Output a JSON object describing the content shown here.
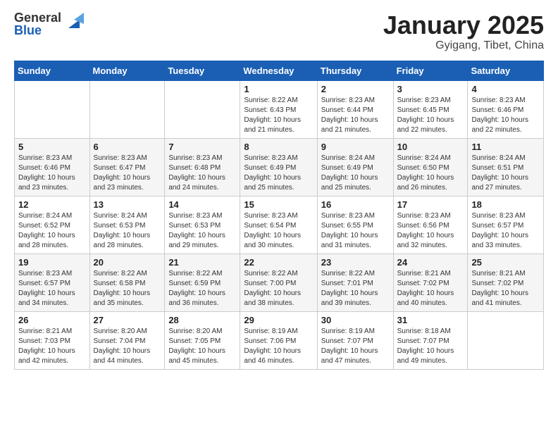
{
  "header": {
    "logo_general": "General",
    "logo_blue": "Blue",
    "month_title": "January 2025",
    "location": "Gyigang, Tibet, China"
  },
  "days_of_week": [
    "Sunday",
    "Monday",
    "Tuesday",
    "Wednesday",
    "Thursday",
    "Friday",
    "Saturday"
  ],
  "weeks": [
    [
      {
        "day": "",
        "info": ""
      },
      {
        "day": "",
        "info": ""
      },
      {
        "day": "",
        "info": ""
      },
      {
        "day": "1",
        "info": "Sunrise: 8:22 AM\nSunset: 6:43 PM\nDaylight: 10 hours and 21 minutes."
      },
      {
        "day": "2",
        "info": "Sunrise: 8:23 AM\nSunset: 6:44 PM\nDaylight: 10 hours and 21 minutes."
      },
      {
        "day": "3",
        "info": "Sunrise: 8:23 AM\nSunset: 6:45 PM\nDaylight: 10 hours and 22 minutes."
      },
      {
        "day": "4",
        "info": "Sunrise: 8:23 AM\nSunset: 6:46 PM\nDaylight: 10 hours and 22 minutes."
      }
    ],
    [
      {
        "day": "5",
        "info": "Sunrise: 8:23 AM\nSunset: 6:46 PM\nDaylight: 10 hours and 23 minutes."
      },
      {
        "day": "6",
        "info": "Sunrise: 8:23 AM\nSunset: 6:47 PM\nDaylight: 10 hours and 23 minutes."
      },
      {
        "day": "7",
        "info": "Sunrise: 8:23 AM\nSunset: 6:48 PM\nDaylight: 10 hours and 24 minutes."
      },
      {
        "day": "8",
        "info": "Sunrise: 8:23 AM\nSunset: 6:49 PM\nDaylight: 10 hours and 25 minutes."
      },
      {
        "day": "9",
        "info": "Sunrise: 8:24 AM\nSunset: 6:49 PM\nDaylight: 10 hours and 25 minutes."
      },
      {
        "day": "10",
        "info": "Sunrise: 8:24 AM\nSunset: 6:50 PM\nDaylight: 10 hours and 26 minutes."
      },
      {
        "day": "11",
        "info": "Sunrise: 8:24 AM\nSunset: 6:51 PM\nDaylight: 10 hours and 27 minutes."
      }
    ],
    [
      {
        "day": "12",
        "info": "Sunrise: 8:24 AM\nSunset: 6:52 PM\nDaylight: 10 hours and 28 minutes."
      },
      {
        "day": "13",
        "info": "Sunrise: 8:24 AM\nSunset: 6:53 PM\nDaylight: 10 hours and 28 minutes."
      },
      {
        "day": "14",
        "info": "Sunrise: 8:23 AM\nSunset: 6:53 PM\nDaylight: 10 hours and 29 minutes."
      },
      {
        "day": "15",
        "info": "Sunrise: 8:23 AM\nSunset: 6:54 PM\nDaylight: 10 hours and 30 minutes."
      },
      {
        "day": "16",
        "info": "Sunrise: 8:23 AM\nSunset: 6:55 PM\nDaylight: 10 hours and 31 minutes."
      },
      {
        "day": "17",
        "info": "Sunrise: 8:23 AM\nSunset: 6:56 PM\nDaylight: 10 hours and 32 minutes."
      },
      {
        "day": "18",
        "info": "Sunrise: 8:23 AM\nSunset: 6:57 PM\nDaylight: 10 hours and 33 minutes."
      }
    ],
    [
      {
        "day": "19",
        "info": "Sunrise: 8:23 AM\nSunset: 6:57 PM\nDaylight: 10 hours and 34 minutes."
      },
      {
        "day": "20",
        "info": "Sunrise: 8:22 AM\nSunset: 6:58 PM\nDaylight: 10 hours and 35 minutes."
      },
      {
        "day": "21",
        "info": "Sunrise: 8:22 AM\nSunset: 6:59 PM\nDaylight: 10 hours and 36 minutes."
      },
      {
        "day": "22",
        "info": "Sunrise: 8:22 AM\nSunset: 7:00 PM\nDaylight: 10 hours and 38 minutes."
      },
      {
        "day": "23",
        "info": "Sunrise: 8:22 AM\nSunset: 7:01 PM\nDaylight: 10 hours and 39 minutes."
      },
      {
        "day": "24",
        "info": "Sunrise: 8:21 AM\nSunset: 7:02 PM\nDaylight: 10 hours and 40 minutes."
      },
      {
        "day": "25",
        "info": "Sunrise: 8:21 AM\nSunset: 7:02 PM\nDaylight: 10 hours and 41 minutes."
      }
    ],
    [
      {
        "day": "26",
        "info": "Sunrise: 8:21 AM\nSunset: 7:03 PM\nDaylight: 10 hours and 42 minutes."
      },
      {
        "day": "27",
        "info": "Sunrise: 8:20 AM\nSunset: 7:04 PM\nDaylight: 10 hours and 44 minutes."
      },
      {
        "day": "28",
        "info": "Sunrise: 8:20 AM\nSunset: 7:05 PM\nDaylight: 10 hours and 45 minutes."
      },
      {
        "day": "29",
        "info": "Sunrise: 8:19 AM\nSunset: 7:06 PM\nDaylight: 10 hours and 46 minutes."
      },
      {
        "day": "30",
        "info": "Sunrise: 8:19 AM\nSunset: 7:07 PM\nDaylight: 10 hours and 47 minutes."
      },
      {
        "day": "31",
        "info": "Sunrise: 8:18 AM\nSunset: 7:07 PM\nDaylight: 10 hours and 49 minutes."
      },
      {
        "day": "",
        "info": ""
      }
    ]
  ]
}
